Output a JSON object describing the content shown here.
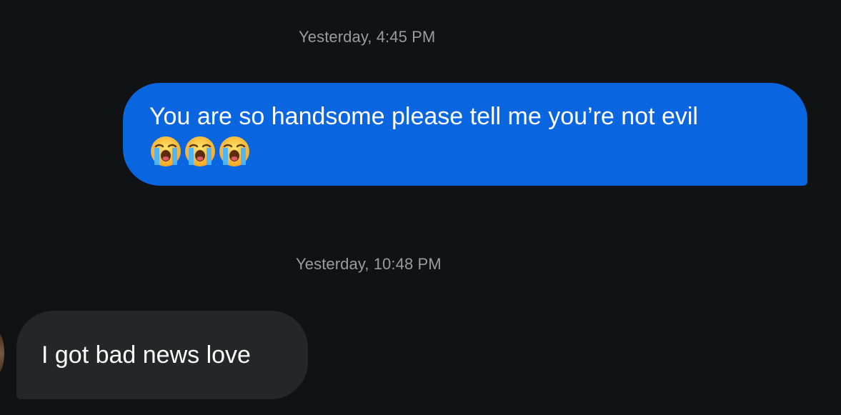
{
  "conversation": {
    "messages": [
      {
        "timestamp": "Yesterday, 4:45 PM",
        "direction": "sent",
        "text": "You are so handsome please tell me you’re not evil",
        "emojis": [
          "loudly-crying-face",
          "loudly-crying-face",
          "loudly-crying-face"
        ]
      },
      {
        "timestamp": "Yesterday, 10:48 PM",
        "direction": "received",
        "text": "I got bad news love"
      }
    ]
  },
  "colors": {
    "background": "#111214",
    "sent_bubble": "#0a66e0",
    "received_bubble": "#252629",
    "timestamp_text": "#9a9ba1",
    "message_text": "#ffffff"
  }
}
